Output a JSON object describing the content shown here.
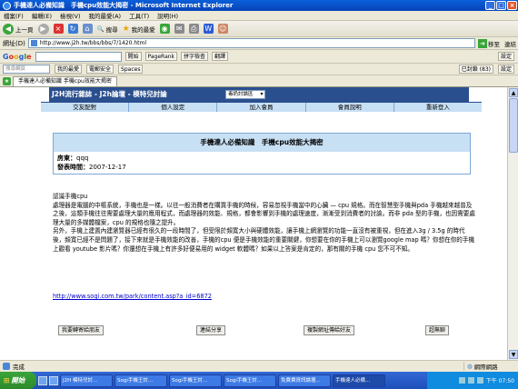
{
  "window": {
    "title": "手機達人必備知識　手機cpu效能大揭密 - Microsoft Internet Explorer",
    "buttons": [
      "_",
      "□",
      "×"
    ]
  },
  "menu": [
    "檔案(F)",
    "編輯(E)",
    "檢視(V)",
    "我的最愛(A)",
    "工具(T)",
    "說明(H)"
  ],
  "toolbar": {
    "back": "上一頁",
    "search": "搜尋",
    "favorites": "我的最愛"
  },
  "address": {
    "label": "網址(D)",
    "url": "http://www.j2h.tw/bbs/bbs/7/1420.html",
    "go": "移至",
    "links": "連結"
  },
  "google": {
    "logo": [
      "G",
      "o",
      "o",
      "g",
      "l",
      "e"
    ],
    "start": "開始",
    "pagerank": "PageRank",
    "spelling": "拼字檢查",
    "translate": "翻譯",
    "settings": "設定"
  },
  "searchbar2": {
    "placeholder": "搜尋網頁",
    "favorites": "我的最愛",
    "email": "電郵安全",
    "spaces": "Spaces",
    "blocked": "已封鎖 (83)",
    "settings": "設定"
  },
  "tabs": [
    {
      "label": "手機達人必備知識 手機cpu效能大揭密",
      "active": true
    }
  ],
  "site": {
    "header": "J2H流行雜誌 - J2h論壇 - 模特兒討論",
    "forum_select": "毒奶討論區",
    "nav": [
      "交友配對",
      "個人設定",
      "加入會員",
      "會員說明",
      "重新登入"
    ]
  },
  "post": {
    "title": "手機達人必備知識　手機cpu效能大揭密",
    "author_label": "房東：",
    "author": "qqq",
    "time_label": "發表時間：",
    "time": "2007-12-17",
    "body": [
      "認識手機cpu",
      "處理器是電腦的中樞系統，手機也是一樣。以往一般消費者在購買手機的時候，容易忽視手機當中的心臟 — cpu 規格。而在智慧型手機與pda 手機越來越普及之後，這類手機往往需要處理大量的應用程式，而處理器的效能、規格，都會影響到手機的處理速度，漸漸受到消費者的討論。而非 pda 型的手機，也因需要處理大量的多媒體檔案，cpu 的規格也隨之提升。",
      "另外，手機上建置內建瀏覽器已經有很久的一段時間了，但受限於頻寬大小與硬體效能，讓手機上網瀏覽的功能一直沒有被重視，但在進入3g / 3.5g 的時代後，頻寬已經不是問題了，接下來就是手機效能的改善，手機的cpu 便是手機效能的重要關鍵，你想要在你的手機上可以瀏覽google map 嗎？你想在你的手機上觀看 youtube 影片嗎？你還想在手機上有許多好便易用的 widget 軟體嗎？如果以上答案是肯定的，那有關的手機 cpu 您不可不知。"
    ],
    "link": "http://www.sogi.com.tw/park/content.asp?a_id=6872"
  },
  "actions": [
    "我要轉寄給朋友",
    "連結分享",
    "複製網址傳給好友",
    "超無聊"
  ],
  "status": {
    "text": "完成",
    "zone": "網際網路"
  },
  "taskbar": {
    "start": "開始",
    "tasks": [
      "J2H 模特兒討...",
      "Sogi手機王討...",
      "Sogi手機王討...",
      "Sogi手機王討...",
      "免費費資訊論壇...",
      "手機達人必備..."
    ],
    "active_index": 5,
    "clock": "下午 07:50"
  }
}
